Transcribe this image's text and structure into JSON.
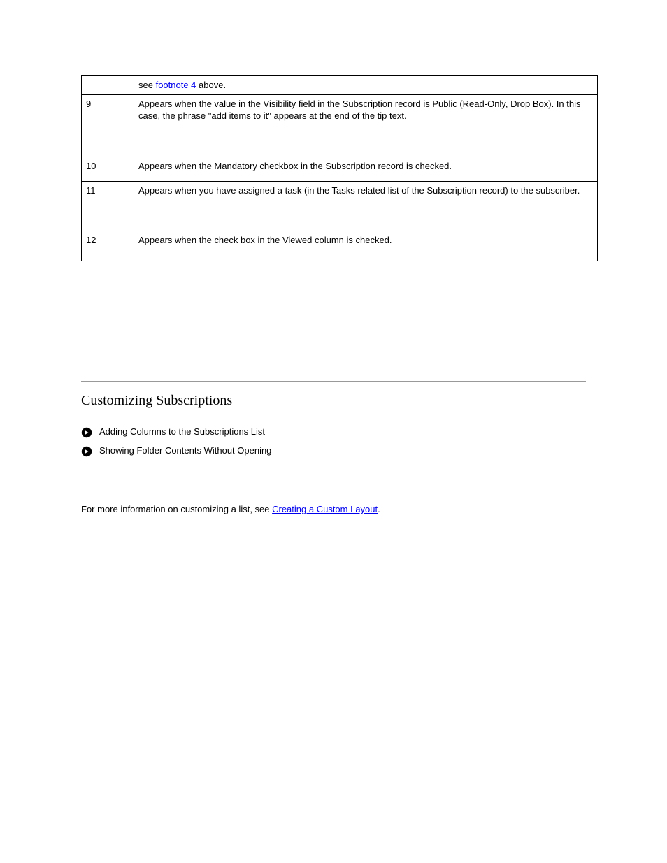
{
  "table": {
    "rows": [
      {
        "num": "",
        "desc_pre": "see ",
        "desc_link": "footnote 4",
        "desc_post": " above."
      },
      {
        "num": "9",
        "desc": "Appears when the value in the Visibility field in the Subscription record is Public (Read-Only, Drop Box). In this case, the phrase \"add items to it\" appears at the end of the tip text."
      },
      {
        "num": "10",
        "desc": "Appears when the Mandatory checkbox in the Subscription record is checked."
      },
      {
        "num": "11",
        "desc": "Appears when you have assigned a task (in the Tasks related list of the Subscription record) to the subscriber."
      },
      {
        "num": "12",
        "desc": "Appears when the check box in the Viewed column is checked."
      }
    ]
  },
  "heading": "Customizing Subscriptions",
  "bullets": [
    "Adding Columns to the Subscriptions List",
    "Showing Folder Contents Without Opening"
  ],
  "para": {
    "pre": "For more information on customizing a list, see ",
    "link": "Creating a Custom Layout",
    "post": "."
  }
}
